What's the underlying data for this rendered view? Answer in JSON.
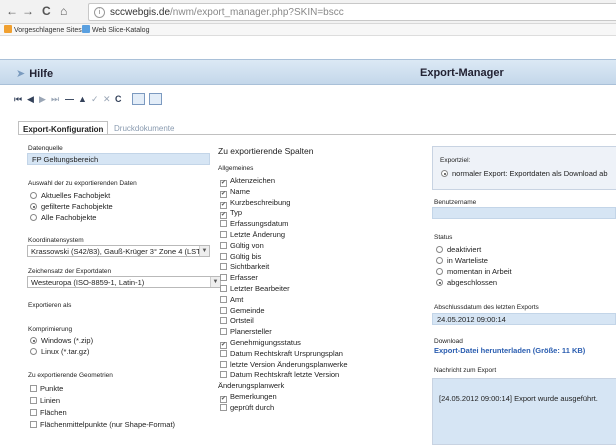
{
  "browser": {
    "url_host": "sccwebgis.de",
    "url_path": "/nwm/export_manager.php?SKIN=bscc",
    "bookmarks": [
      "Vorgeschlagene Sites",
      "Web Slice-Katalog"
    ]
  },
  "header": {
    "help": "Hilfe",
    "title": "Export-Manager"
  },
  "tabs": [
    "Export-Konfiguration",
    "Druckdokumente"
  ],
  "left": {
    "datenquelle_label": "Datenquelle",
    "datenquelle_value": "FP Geltungsbereich",
    "auswahl_label": "Auswahl der zu exportierenden Daten",
    "auswahl_options": [
      "Aktuelles Fachobjekt",
      "gefilterte Fachobjekte",
      "Alle Fachobjekte"
    ],
    "koord_label": "Koordinatensystem",
    "koord_value": "Krassowski (S42/83), Gauß-Krüger 3° Zone 4 (LST",
    "zeichensatz_label": "Zeichensatz der Exportdaten",
    "zeichensatz_value": "Westeuropa (ISO-8859-1, Latin-1)",
    "exportieren_label": "Exportieren als",
    "komprimierung_label": "Komprimierung",
    "komprimierung_options": [
      "Windows (*.zip)",
      "Linux (*.tar.gz)"
    ],
    "geometrien_label": "Zu exportierende Geometrien",
    "geometrien": [
      "Punkte",
      "Linien",
      "Flächen",
      "Flächenmittelpunkte (nur Shape-Format)"
    ]
  },
  "middle": {
    "title": "Zu exportierende Spalten",
    "group": "Allgemeines",
    "columns": [
      {
        "label": "Aktenzeichen",
        "checked": true
      },
      {
        "label": "Name",
        "checked": true
      },
      {
        "label": "Kurzbeschreibung",
        "checked": true
      },
      {
        "label": "Typ",
        "checked": true
      },
      {
        "label": "Erfassungsdatum",
        "checked": false
      },
      {
        "label": "Letzte Änderung",
        "checked": false
      },
      {
        "label": "Gültig von",
        "checked": false
      },
      {
        "label": "Gültig bis",
        "checked": false
      },
      {
        "label": "Sichtbarkeit",
        "checked": false
      },
      {
        "label": "Erfasser",
        "checked": false
      },
      {
        "label": "Letzter Bearbeiter",
        "checked": false
      },
      {
        "label": "Amt",
        "checked": false
      },
      {
        "label": "Gemeinde",
        "checked": false
      },
      {
        "label": "Ortsteil",
        "checked": false
      },
      {
        "label": "Planersteller",
        "checked": false
      },
      {
        "label": "Genehmigungsstatus",
        "checked": true
      },
      {
        "label": "Datum Rechtskraft Ursprungsplan",
        "checked": false
      },
      {
        "label": "letzte Version Änderungsplanwerke",
        "checked": false
      },
      {
        "label": "Datum Rechtskraft letzte Version",
        "checked": false
      },
      {
        "label": "Bemerkungen",
        "checked": true
      },
      {
        "label": "geprüft durch",
        "checked": false
      }
    ],
    "wrap_text": "Änderungsplanwerk"
  },
  "right": {
    "exportziel_label": "Exportziel:",
    "exportziel_option": "normaler Export: Exportdaten als Download ab",
    "benutzername_label": "Benutzername",
    "status_label": "Status",
    "status_options": [
      "deaktiviert",
      "in Warteliste",
      "momentan in Arbeit",
      "abgeschlossen"
    ],
    "abschluss_label": "Abschlussdatum des letzten Exports",
    "abschluss_value": "24.05.2012 09:00:14",
    "download_label": "Download",
    "download_link": "Export-Datei herunterladen (Größe: 11 KB)",
    "nachricht_label": "Nachricht zum Export",
    "nachricht_value": "[24.05.2012 09:00:14] Export wurde ausgeführt."
  }
}
